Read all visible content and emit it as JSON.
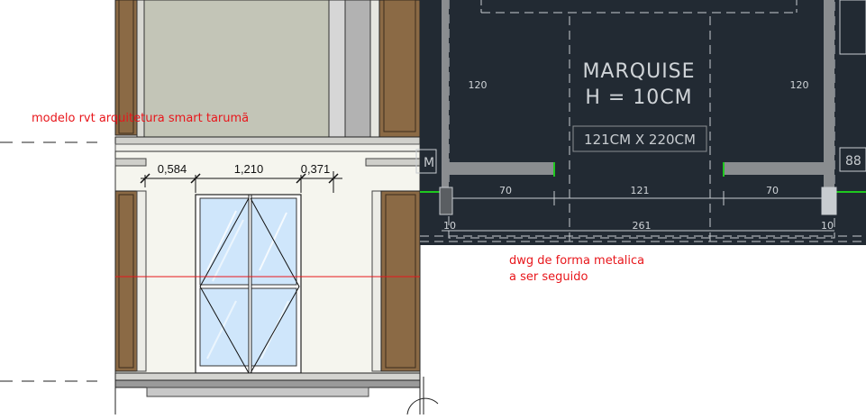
{
  "annotations": {
    "rvt_note": "modelo rvt arquitetura smart tarumã",
    "dwg_note_line1": "dwg de forma metalica",
    "dwg_note_line2": "a ser seguido"
  },
  "revit_view": {
    "dimensions": [
      "0,584",
      "1,210",
      "0,371"
    ]
  },
  "dwg_view": {
    "title_line1": "MARQUISE",
    "title_line2": "H = 10CM",
    "size_label": "121CM X 220CM",
    "left_height": "120",
    "right_height": "120",
    "left_tag": "M",
    "right_tag": "88",
    "bottom_dims": [
      "70",
      "121",
      "70"
    ],
    "pillar_left": "10",
    "pillar_right": "10",
    "total": "261",
    "colors": {
      "background": "#222a33",
      "line": "#c8ccd0",
      "wall": "#8a8d90",
      "accent": "#1fc81f"
    }
  },
  "revit_colors": {
    "wood": "#8b6a45",
    "wall_fill": "#f5f5ee",
    "glass": "#cfe6fb",
    "section_line": "#e8161b"
  }
}
